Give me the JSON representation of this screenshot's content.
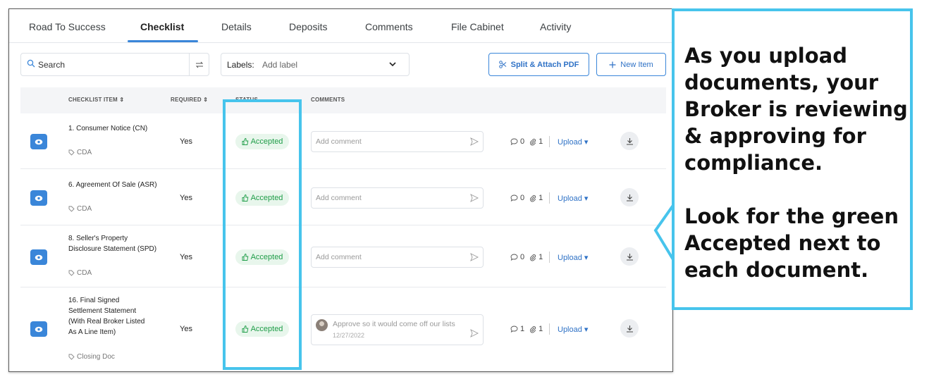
{
  "tabs": [
    {
      "label": "Road To Success",
      "active": false
    },
    {
      "label": "Checklist",
      "active": true
    },
    {
      "label": "Details",
      "active": false
    },
    {
      "label": "Deposits",
      "active": false
    },
    {
      "label": "Comments",
      "active": false
    },
    {
      "label": "File Cabinet",
      "active": false
    },
    {
      "label": "Activity",
      "active": false
    }
  ],
  "toolbar": {
    "search_placeholder": "Search",
    "labels_title": "Labels:",
    "labels_placeholder": "Add label",
    "split_label": "Split & Attach PDF",
    "new_item_label": "New Item"
  },
  "table": {
    "headers": {
      "item": "CHECKLIST ITEM ⇕",
      "required": "REQUIRED ⇕",
      "status": "STATUS",
      "comments": "COMMENTS"
    },
    "rows": [
      {
        "title": "1. Consumer Notice (CN)",
        "tag": "CDA",
        "required": "Yes",
        "status": "Accepted",
        "comment_placeholder": "Add comment",
        "comments_count": "0",
        "attachments_count": "1",
        "upload_label": "Upload"
      },
      {
        "title": "6. Agreement Of Sale (ASR)",
        "tag": "CDA",
        "required": "Yes",
        "status": "Accepted",
        "comment_placeholder": "Add comment",
        "comments_count": "0",
        "attachments_count": "1",
        "upload_label": "Upload"
      },
      {
        "title": "8. Seller's Property Disclosure Statement (SPD)",
        "tag": "CDA",
        "required": "Yes",
        "status": "Accepted",
        "comment_placeholder": "Add comment",
        "comments_count": "0",
        "attachments_count": "1",
        "upload_label": "Upload"
      },
      {
        "title": "16. Final Signed Settlement Statement (With Real Broker Listed As A Line Item)",
        "tag": "Closing Doc",
        "required": "Yes",
        "status": "Accepted",
        "comment_text": "Approve so it would come off our lists",
        "comment_date": "12/27/2022",
        "comments_count": "1",
        "attachments_count": "1",
        "upload_label": "Upload"
      }
    ]
  },
  "callout": {
    "paragraph1": "As you upload documents, your Broker is reviewing & approving for compliance.",
    "paragraph2": "Look for the green Accepted next to each document."
  },
  "colors": {
    "accent_blue": "#3a86d9",
    "accepted_green": "#1f9d48",
    "highlight_cyan": "#47c4ec"
  }
}
